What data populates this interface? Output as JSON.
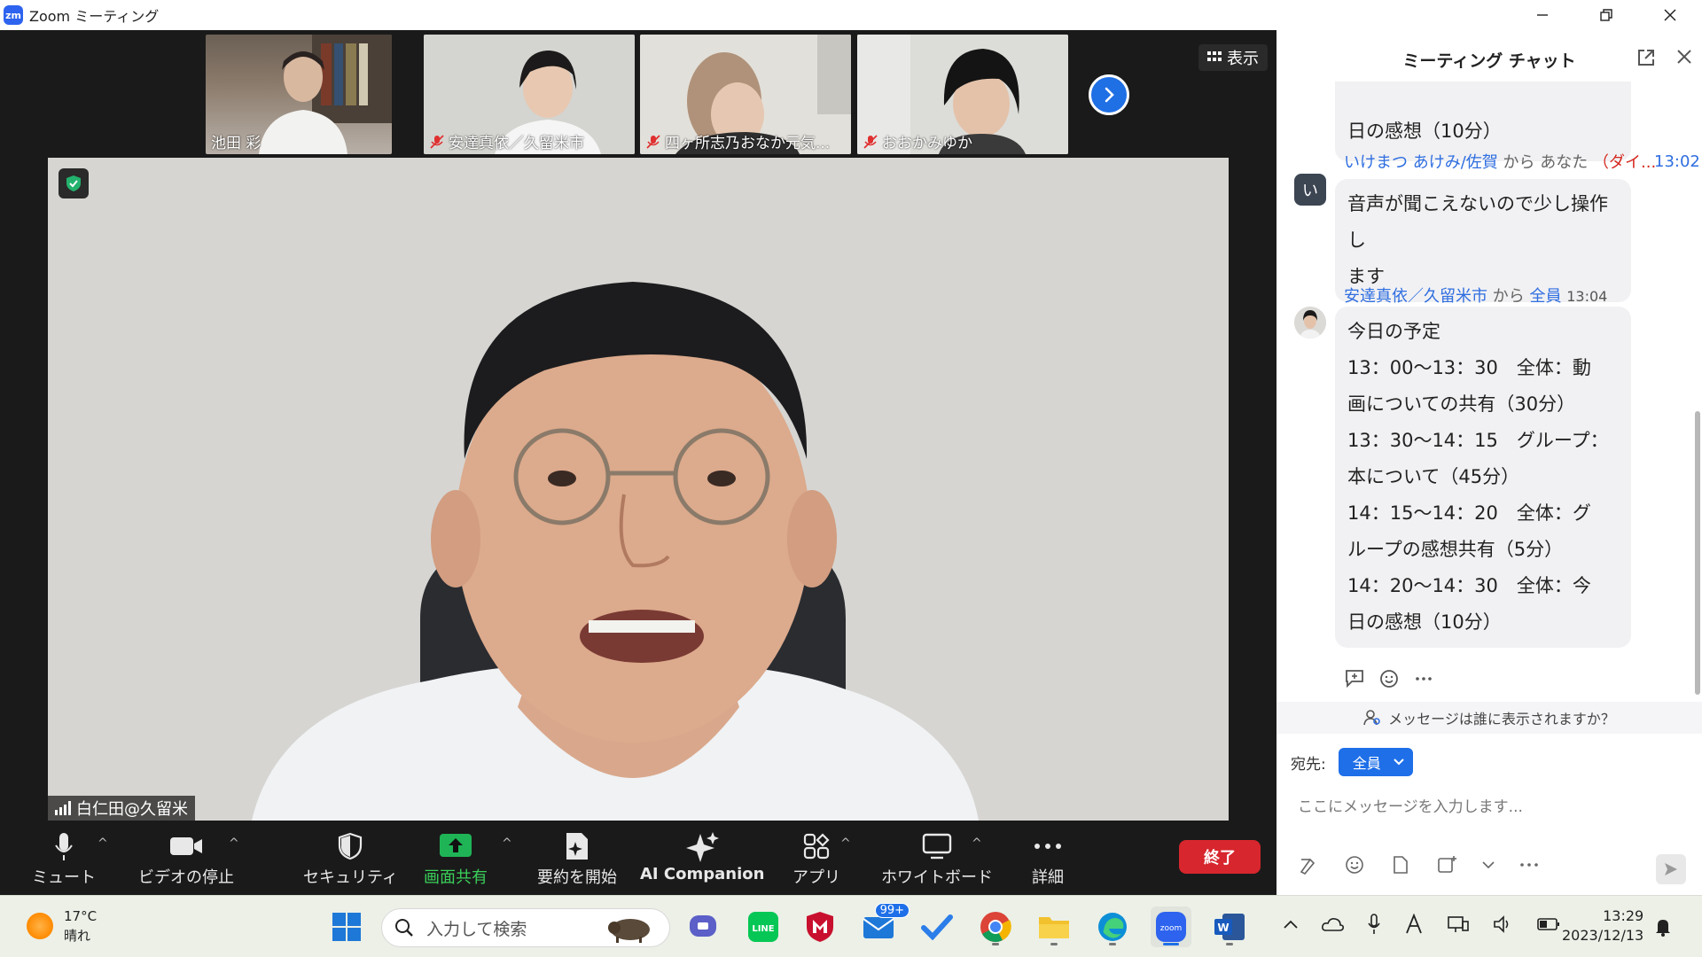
{
  "window": {
    "title": "Zoom ミーティング"
  },
  "thumbnails": [
    {
      "name": "池田 彩",
      "muted": false
    },
    {
      "name": "安達真依／久留米市",
      "muted": true
    },
    {
      "name": "四ヶ所志乃おなか元気...",
      "muted": true
    },
    {
      "name": "おおかみゆか",
      "muted": true
    }
  ],
  "view_button": {
    "label": "表示"
  },
  "main_speaker": {
    "name": "白仁田@久留米"
  },
  "toolbar": {
    "mute": "ミュート",
    "stop_video": "ビデオの停止",
    "security": "セキュリティ",
    "share_screen": "画面共有",
    "summary": "要約を開始",
    "ai_companion": "AI Companion",
    "apps": "アプリ",
    "whiteboard": "ホワイトボード",
    "more": "詳細",
    "end": "終了"
  },
  "chat": {
    "title": "ミーティング チャット",
    "partial_message": "日の感想（10分）",
    "messages": [
      {
        "sender": "いけまつ あけみ/佐賀",
        "from_word": "から",
        "to": "あなた",
        "dm_tag": "（ダイ...",
        "time": "13:02",
        "avatar_letter": "い",
        "lines": [
          "音声が聞こえないので少し操作し",
          "ます"
        ]
      },
      {
        "sender": "安達真依／久留米市",
        "from_word": "から",
        "to": "全員",
        "time": "13:04",
        "lines": [
          "今日の予定",
          "13：00〜13：30　全体：動",
          "画についての共有（30分）",
          "13：30〜14：15　グループ：",
          "本について（45分）",
          "14：15〜14：20　全体：グ",
          "ループの感想共有（5分）",
          "14：20〜14：30　全体：今",
          "日の感想（10分）"
        ]
      }
    ],
    "visibility_text": "メッセージは誰に表示されますか？",
    "to_label": "宛先:",
    "to_value": "全員",
    "input_placeholder": "ここにメッセージを入力します..."
  },
  "taskbar": {
    "temperature": "17°C",
    "weather": "晴れ",
    "search_placeholder": "入力して検索",
    "mail_badge": "99+",
    "time": "13:29",
    "date": "2023/12/13"
  }
}
